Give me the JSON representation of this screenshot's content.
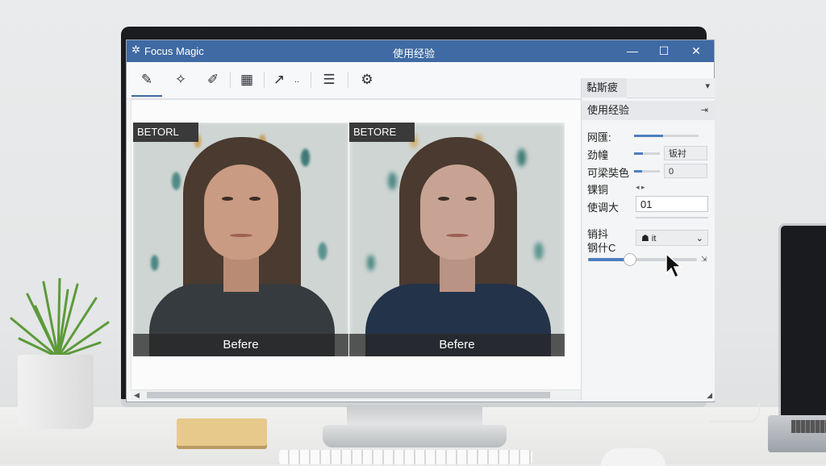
{
  "window": {
    "app_name": "Focus Magic",
    "title": "使用经验",
    "minimize": "—",
    "maximize": "☐",
    "close": "✕"
  },
  "toolbar": {
    "tools": [
      {
        "icon": "select-brush-icon",
        "glyph": "✎"
      },
      {
        "icon": "magic-wand-icon",
        "glyph": "✧"
      },
      {
        "icon": "pencil-icon",
        "glyph": "✐"
      },
      {
        "icon": "image-compare-icon",
        "glyph": "▦"
      },
      {
        "icon": "crop-icon",
        "glyph": "↗"
      },
      {
        "icon": "list-settings-icon",
        "glyph": "☰"
      },
      {
        "icon": "gear-icon",
        "glyph": "⚙"
      }
    ],
    "crop_suffix": ".."
  },
  "images": {
    "left": {
      "tag": "BETORL",
      "caption": "Befere"
    },
    "right": {
      "tag": "BETORE",
      "caption": "Befere"
    }
  },
  "panel": {
    "tab": "黏斯疲",
    "section_title": "使用经验",
    "rows": [
      {
        "label": "网匯:",
        "slider": 0.45
      },
      {
        "label": "劲幢",
        "slider": 0.35,
        "value": "钣衬"
      },
      {
        "label": "可梁奘色",
        "slider": 0.3,
        "value": "0"
      },
      {
        "label": "锞铜"
      }
    ],
    "input_label": "使调大",
    "input_value": "01",
    "select_label_1": "销抖",
    "select_label_2": "钢什C",
    "select_value": "it",
    "slider_value": 0.38
  },
  "colors": {
    "titlebar": "#3f6aa3",
    "accent": "#4e7ec0"
  }
}
